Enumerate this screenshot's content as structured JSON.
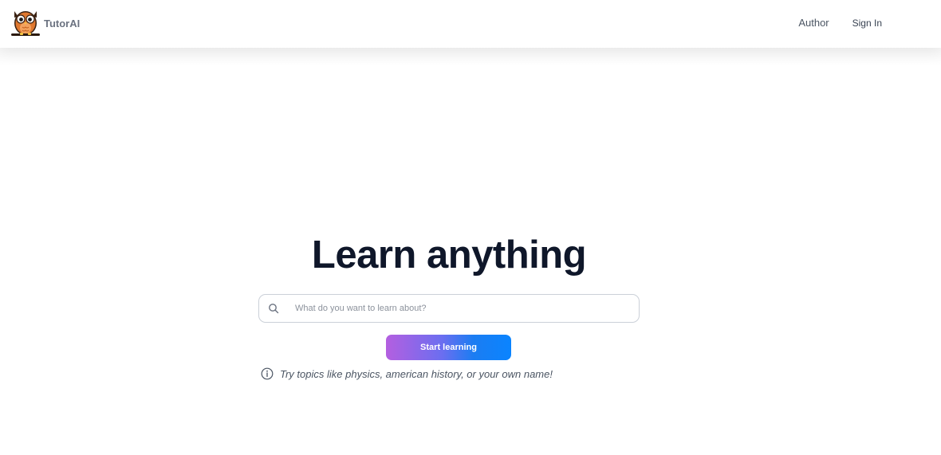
{
  "header": {
    "brand": "TutorAI",
    "logo_icon": "owl-logo-icon",
    "nav": {
      "author": "Author",
      "sign_in": "Sign In"
    }
  },
  "hero": {
    "title": "Learn anything",
    "search": {
      "icon": "search-icon",
      "placeholder": "What do you want to learn about?",
      "value": ""
    },
    "cta_label": "Start learning",
    "hint": {
      "icon": "info-icon",
      "text": "Try topics like physics, american history, or your own name!"
    }
  },
  "colors": {
    "title": "#0f172a",
    "button_gradient_start": "#b45fe0",
    "button_gradient_end": "#0a84ff",
    "logo_orange": "#e0782f"
  }
}
